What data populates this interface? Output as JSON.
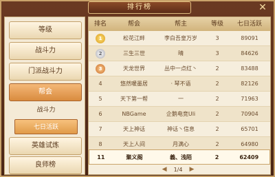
{
  "window": {
    "title": "排行榜",
    "close_glyph": "✕"
  },
  "sidebar": {
    "tabs": [
      {
        "label": "等级"
      },
      {
        "label": "战斗力"
      },
      {
        "label": "门派战斗力"
      },
      {
        "label": "帮会"
      },
      {
        "label": "英雄试炼"
      },
      {
        "label": "良师榜"
      }
    ],
    "subtabs": [
      {
        "label": "战斗力"
      },
      {
        "label": "七日活跃"
      }
    ]
  },
  "table": {
    "headers": {
      "rank": "排名",
      "guild": "帮会",
      "leader": "帮主",
      "level": "等级",
      "activity": "七日活跃"
    },
    "rows": [
      {
        "rank": "1",
        "guild": "松花江畔",
        "leader": "李白吾皇万岁",
        "level": "3",
        "activity": "89091"
      },
      {
        "rank": "2",
        "guild": "三生三世",
        "leader": "晴",
        "level": "3",
        "activity": "84626"
      },
      {
        "rank": "3",
        "guild": "天龙世界",
        "leader": "丛中一点红丶",
        "level": "2",
        "activity": "83488"
      },
      {
        "rank": "4",
        "guild": "悠然暖墨居",
        "leader": "· 琴不语",
        "level": "2",
        "activity": "82126"
      },
      {
        "rank": "5",
        "guild": "天下第一帮",
        "leader": "一",
        "level": "2",
        "activity": "71963"
      },
      {
        "rank": "6",
        "guild": "NBGame",
        "leader": "企鹅电竞Uli",
        "level": "2",
        "activity": "70904"
      },
      {
        "rank": "7",
        "guild": "天上神话",
        "leader": "神话丶信息",
        "level": "2",
        "activity": "65701"
      },
      {
        "rank": "8",
        "guild": "天上人间",
        "leader": "月满心",
        "level": "2",
        "activity": "64980"
      }
    ],
    "self_row": {
      "rank": "11",
      "guild": "聚义阁",
      "leader": "義、浅陌",
      "level": "2",
      "activity": "62409"
    }
  },
  "pager": {
    "text": "1/4",
    "prev": "◀",
    "next": "▶"
  },
  "colors": {
    "accent": "#d98b3e",
    "frame": "#4a2616",
    "panel": "#f6eedd"
  }
}
